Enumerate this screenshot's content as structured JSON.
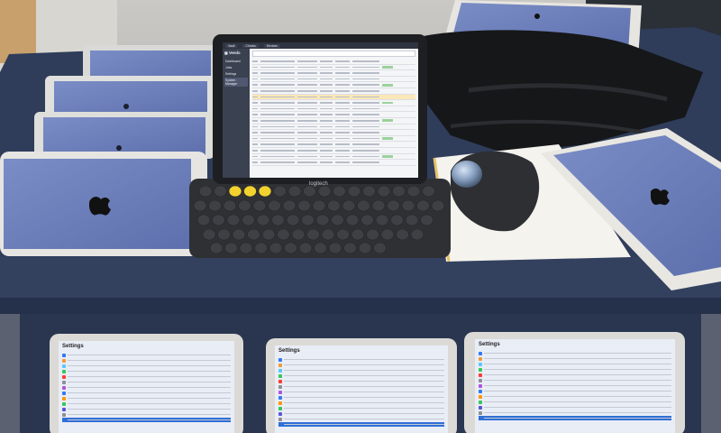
{
  "keyboard": {
    "brand": "logitech"
  },
  "ipad_app": {
    "tabs": [
      "Vault",
      "Checks",
      "Devices"
    ],
    "brand": "Vendo",
    "sidebar_items": [
      "Dashboard",
      "Jobs",
      "Settings",
      "System Manager"
    ],
    "table_rows": 18,
    "highlighted_row": 6
  },
  "lower_ipads": [
    {
      "title": "Settings"
    },
    {
      "title": "Settings"
    },
    {
      "title": "Settings"
    }
  ],
  "colors": {
    "cart": "#2d3a55",
    "ipad_blue_screen": "#6d80b8",
    "keyboard_keys_accent": "#f2d22e",
    "mat": "#f5f3ee"
  }
}
